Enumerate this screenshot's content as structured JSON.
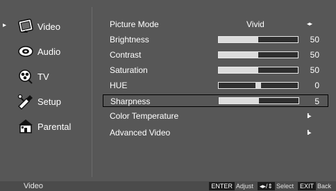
{
  "sidebar": {
    "items": [
      {
        "label": "Video",
        "icon": "video-icon",
        "selected": true
      },
      {
        "label": "Audio",
        "icon": "audio-icon"
      },
      {
        "label": "TV",
        "icon": "tv-icon"
      },
      {
        "label": "Setup",
        "icon": "setup-icon"
      },
      {
        "label": "Parental",
        "icon": "parental-icon"
      }
    ],
    "pointer": "▸"
  },
  "menu": {
    "picture_mode": {
      "label": "Picture Mode",
      "value": "Vivid",
      "arrows": "◂▸"
    },
    "brightness": {
      "label": "Brightness",
      "value": "50",
      "level": 0.5
    },
    "contrast": {
      "label": "Contrast",
      "value": "50",
      "level": 0.5
    },
    "saturation": {
      "label": "Saturation",
      "value": "50",
      "level": 0.5
    },
    "hue": {
      "label": "HUE",
      "value": "0",
      "level": 0.5
    },
    "sharpness": {
      "label": "Sharpness",
      "value": "5",
      "level": 0.5,
      "selected": true
    },
    "color_temperature": {
      "label": "Color Temperature",
      "go": "II▸"
    },
    "advanced_video": {
      "label": "Advanced Video",
      "go": "II▸"
    }
  },
  "footer": {
    "title": "Video",
    "enter_key": "ENTER",
    "enter_text": "Adjust",
    "nav_key": "◂▸/⇕",
    "nav_text": "Select",
    "exit_key": "EXIT",
    "exit_text": "Back"
  },
  "colors": {
    "background": "#575757",
    "bar_track": "#2f2f2f",
    "bar_fill": "#dcdcdc",
    "footer": "#4b4b4b"
  }
}
